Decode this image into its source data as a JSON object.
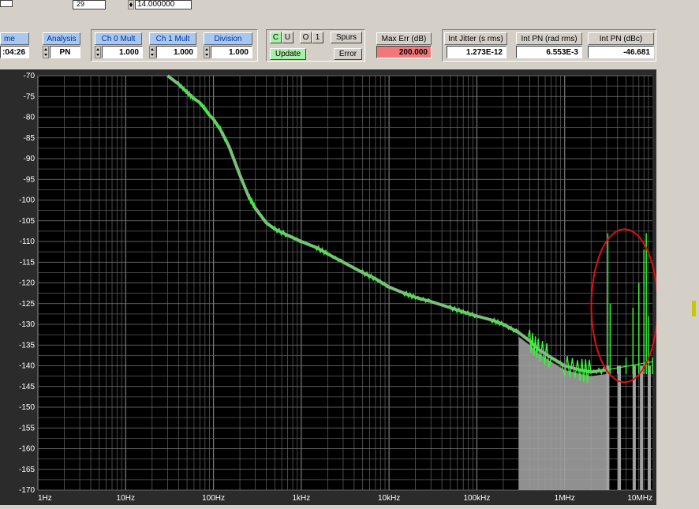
{
  "top": {
    "field_29": "29",
    "field_freq": "14.000000"
  },
  "controls": {
    "time_label": "me",
    "time_value": ":04:26",
    "analysis_label": "Analysis",
    "analysis_value": "PN",
    "ch0_label": "Ch 0 Mult",
    "ch0_value": "1.000",
    "ch1_label": "Ch 1 Mult",
    "ch1_value": "1.000",
    "division_label": "Division",
    "division_value": "1.000",
    "c_label": "C",
    "u_label": "U",
    "o_label": "O",
    "one_label": "1",
    "spurs_label": "Spurs",
    "update_label": "Update",
    "error_label": "Error",
    "maxerr_label": "Max Err (dB)",
    "maxerr_value": "200.000",
    "jitter_label": "Int Jitter (s rms)",
    "jitter_value": "1.273E-12",
    "intpn_rad_label": "Int PN (rad rms)",
    "intpn_rad_value": "6.553E-3",
    "intpn_dbc_label": "Int PN (dBc)",
    "intpn_dbc_value": "-46.681"
  },
  "colors": {
    "trace": "#3cf03c",
    "trace_shadow": "#a0a0a0",
    "spur_circle": "#e01010",
    "plot_bg": "#000000",
    "grid": "#5a5a5a",
    "maxerr_bg": "#f07878",
    "update_bg": "#a8f0a8"
  },
  "chart_data": {
    "type": "line",
    "xscale": "log",
    "xlim": [
      1,
      10000000
    ],
    "ylim": [
      -170,
      -70
    ],
    "x_tick_labels": [
      "1Hz",
      "10Hz",
      "100Hz",
      "1kHz",
      "10kHz",
      "100kHz",
      "1MHz",
      "10MHz"
    ],
    "y_tick_labels": [
      "-70",
      "-75",
      "-80",
      "-85",
      "-90",
      "-95",
      "-100",
      "-105",
      "-110",
      "-115",
      "-120",
      "-125",
      "-130",
      "-135",
      "-140",
      "-145",
      "-150",
      "-155",
      "-160",
      "-165",
      "-170"
    ],
    "grid": true,
    "annotation": "red circle around spurs near 3MHz-10MHz",
    "series": [
      {
        "x": [
          30,
          40,
          50,
          60,
          70,
          80,
          90,
          100,
          120,
          150,
          200,
          250,
          300,
          400,
          500,
          700,
          1000,
          1500,
          2000,
          3000,
          5000,
          7000,
          10000,
          15000,
          20000,
          30000,
          50000,
          70000,
          100000,
          150000,
          200000,
          300000,
          400000,
          500000,
          700000,
          1000000,
          1500000,
          2000000,
          3000000
        ],
        "y": [
          -70,
          -72,
          -74,
          -75.5,
          -76.5,
          -78,
          -79.5,
          -80.5,
          -83,
          -87,
          -94,
          -99,
          -102,
          -105.5,
          -107,
          -108.5,
          -110,
          -111.5,
          -113,
          -115,
          -117.5,
          -119,
          -121,
          -122.5,
          -123.5,
          -124.5,
          -126,
          -127,
          -128,
          -129,
          -130,
          -132,
          -134,
          -136,
          -138,
          -140,
          -141,
          -141.5,
          -141
        ]
      },
      {
        "x": [
          3100000,
          3300000,
          4000000,
          5000000,
          6000000,
          7000000,
          8000000,
          8500000,
          9000000,
          10000000
        ],
        "y": [
          -108,
          -125,
          -140,
          -138,
          -126,
          -120,
          -112,
          -108,
          -128,
          -138
        ]
      }
    ]
  }
}
